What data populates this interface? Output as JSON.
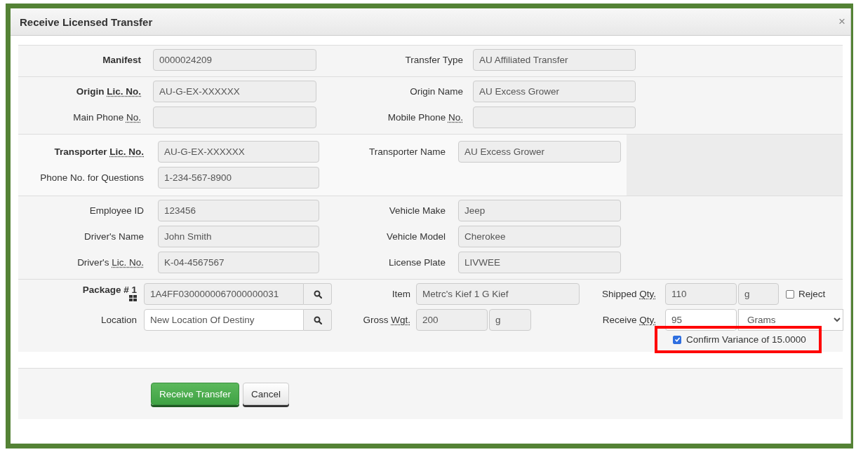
{
  "dialog": {
    "title": "Receive Licensed Transfer",
    "close": "×"
  },
  "sections": [
    {
      "kind": "summary",
      "rows": [
        [
          {
            "label": "Manifest",
            "bold": true,
            "value": "0000024209"
          },
          {
            "label": "Transfer Type",
            "bold": false,
            "value": "AU Affiliated Transfer"
          }
        ]
      ]
    },
    {
      "kind": "summary",
      "rows": [
        [
          {
            "label": "Origin",
            "abbr": "Lic. No.",
            "bold": true,
            "value": "AU-G-EX-XXXXXX"
          },
          {
            "label": "Origin Name",
            "bold": false,
            "value": "AU Excess Grower"
          }
        ],
        [
          {
            "label": "Main Phone",
            "abbr": "No.",
            "bold": false
          },
          {
            "label": "Mobile Phone",
            "abbr": "No.",
            "bold": false
          }
        ]
      ]
    },
    {
      "kind": "panel",
      "rows": [
        [
          {
            "label": "Transporter",
            "abbr": "Lic. No.",
            "bold": true,
            "value": "AU-G-EX-XXXXXX"
          },
          {
            "label": "Transporter Name",
            "bold": false,
            "value": "AU Excess Grower"
          }
        ],
        [
          {
            "label": "Phone No. for Questions",
            "bold": false,
            "value": "1-234-567-8900"
          }
        ]
      ]
    },
    {
      "kind": "plain",
      "rows": [
        [
          {
            "label": "Employee ID",
            "bold": false,
            "value": "123456"
          },
          {
            "label": "Vehicle Make",
            "bold": false,
            "value": "Jeep"
          }
        ],
        [
          {
            "label": "Driver's Name",
            "bold": false,
            "value": "John Smith"
          },
          {
            "label": "Vehicle Model",
            "bold": false,
            "value": "Cherokee"
          }
        ],
        [
          {
            "label": "Driver's",
            "abbr": "Lic. No.",
            "bold": false,
            "value": "K-04-4567567"
          },
          {
            "label": "License Plate",
            "bold": false,
            "value": "LIVWEE"
          }
        ]
      ]
    }
  ],
  "package": {
    "label": "Package # 1",
    "value": "1A4FF0300000067000000031",
    "item_label": "Item",
    "item": "Metrc's Kief 1 G Kief",
    "shipped_label": {
      "label": "Shipped",
      "abbr": "Qty."
    },
    "shipped_qty": "110",
    "shipped_unit": "g",
    "reject": {
      "label": "Reject",
      "checked": false
    },
    "location_label": "Location",
    "location": "New Location Of Destiny",
    "gross_label": {
      "label": "Gross",
      "abbr": "Wgt."
    },
    "gross": "200",
    "gross_unit": "g",
    "receive_label": {
      "label": "Receive",
      "abbr": "Qty."
    },
    "receive_qty": "95",
    "receive_unit": "Grams",
    "variance": {
      "label": "Confirm Variance of 15.0000",
      "checked": true,
      "highlighted": true
    }
  },
  "buttons": [
    {
      "label": "Receive Transfer",
      "kind": "primary"
    },
    {
      "label": "Cancel",
      "kind": "default"
    }
  ]
}
